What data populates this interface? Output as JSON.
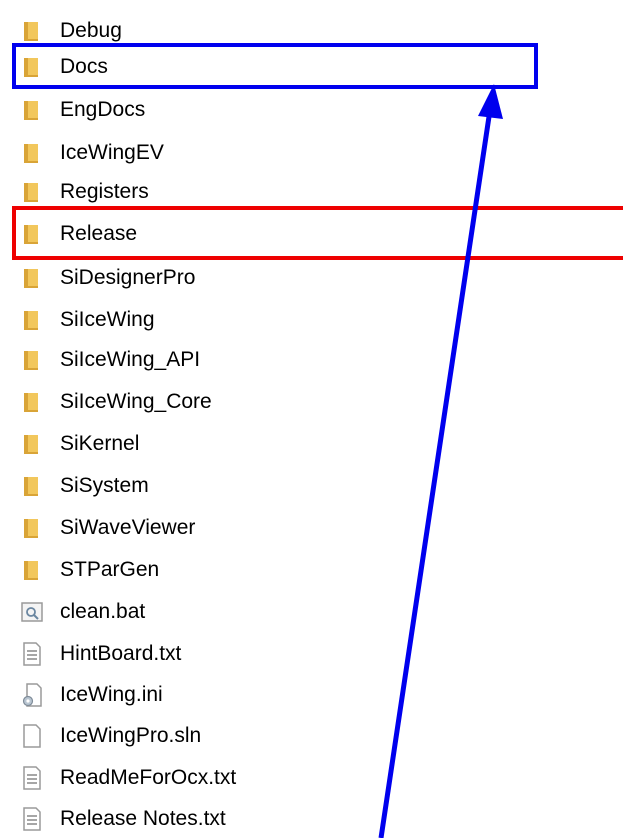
{
  "files": [
    {
      "name": "Debug",
      "icon": "folder-icon",
      "type": "folder"
    },
    {
      "name": "Docs",
      "icon": "folder-icon",
      "type": "folder"
    },
    {
      "name": "EngDocs",
      "icon": "folder-icon",
      "type": "folder"
    },
    {
      "name": "IceWingEV",
      "icon": "folder-icon",
      "type": "folder"
    },
    {
      "name": "Registers",
      "icon": "folder-icon",
      "type": "folder"
    },
    {
      "name": "Release",
      "icon": "folder-icon",
      "type": "folder"
    },
    {
      "name": "SiDesignerPro",
      "icon": "folder-icon",
      "type": "folder"
    },
    {
      "name": "SiIceWing",
      "icon": "folder-icon",
      "type": "folder"
    },
    {
      "name": "SiIceWing_API",
      "icon": "folder-icon",
      "type": "folder"
    },
    {
      "name": "SiIceWing_Core",
      "icon": "folder-icon",
      "type": "folder"
    },
    {
      "name": "SiKernel",
      "icon": "folder-icon",
      "type": "folder"
    },
    {
      "name": "SiSystem",
      "icon": "folder-icon",
      "type": "folder"
    },
    {
      "name": "SiWaveViewer",
      "icon": "folder-icon",
      "type": "folder"
    },
    {
      "name": "STParGen",
      "icon": "folder-icon",
      "type": "folder"
    },
    {
      "name": "clean.bat",
      "icon": "batch-file-icon",
      "type": "bat"
    },
    {
      "name": "HintBoard.txt",
      "icon": "text-file-icon",
      "type": "txt"
    },
    {
      "name": "IceWing.ini",
      "icon": "config-file-icon",
      "type": "ini"
    },
    {
      "name": "IceWingPro.sln",
      "icon": "blank-file-icon",
      "type": "sln"
    },
    {
      "name": "ReadMeForOcx.txt",
      "icon": "text-file-icon",
      "type": "txt"
    },
    {
      "name": "Release Notes.txt",
      "icon": "text-file-icon",
      "type": "txt"
    }
  ],
  "highlights": {
    "blue_target": "Docs",
    "red_target": "Release",
    "blue_color": "#0000ee",
    "red_color": "#ee0000"
  },
  "colors": {
    "folder_body": "#f2c75c",
    "folder_dark": "#d9a437",
    "file_outline": "#9a9a9a"
  }
}
